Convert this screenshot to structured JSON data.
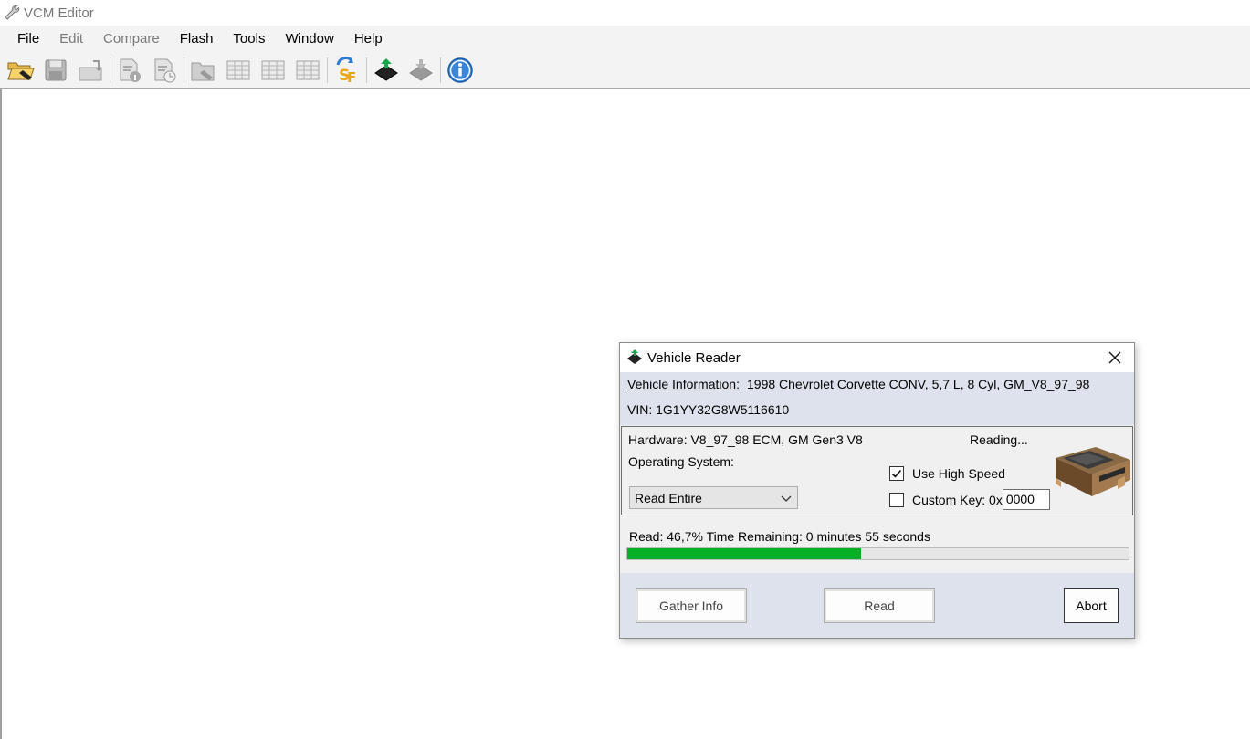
{
  "window": {
    "title": "VCM Editor"
  },
  "menu": {
    "items": [
      {
        "label": "File",
        "enabled": true
      },
      {
        "label": "Edit",
        "enabled": false
      },
      {
        "label": "Compare",
        "enabled": false
      },
      {
        "label": "Flash",
        "enabled": true
      },
      {
        "label": "Tools",
        "enabled": true
      },
      {
        "label": "Window",
        "enabled": true
      },
      {
        "label": "Help",
        "enabled": true
      }
    ]
  },
  "toolbar": {
    "icons": [
      "open-folder-icon",
      "save-icon",
      "undo-icon",
      "file-info-icon",
      "file-history-icon",
      "folder-open-disabled-icon",
      "table-icon",
      "table-edit-icon",
      "table-compare-icon",
      "scan-file-icon",
      "read-vehicle-icon",
      "write-vehicle-icon",
      "info-icon"
    ]
  },
  "dialog": {
    "title": "Vehicle Reader",
    "vehicle_info_label": "Vehicle Information:",
    "vehicle_info_value": "1998 Chevrolet Corvette CONV, 5,7 L, 8 Cyl, GM_V8_97_98",
    "vin": "VIN: 1G1YY32G8W5116610",
    "hardware": "Hardware: V8_97_98 ECM, GM Gen3 V8",
    "status": "Reading...",
    "os_label": "Operating System:",
    "read_mode": "Read Entire",
    "use_high_speed_label": "Use High Speed",
    "use_high_speed": true,
    "custom_key_label": "Custom Key: 0x",
    "custom_key_checked": false,
    "custom_key_value": "0000",
    "progress_text": "Read: 46,7% Time Remaining: 0 minutes 55 seconds",
    "progress_percent": 46.7,
    "buttons": {
      "gather_info": "Gather Info",
      "read": "Read",
      "abort": "Abort"
    }
  },
  "colors": {
    "progress": "#06b025",
    "panel": "#dde2ec",
    "info_blue": "#1f6fd0",
    "chip_green": "#1aa64a"
  }
}
